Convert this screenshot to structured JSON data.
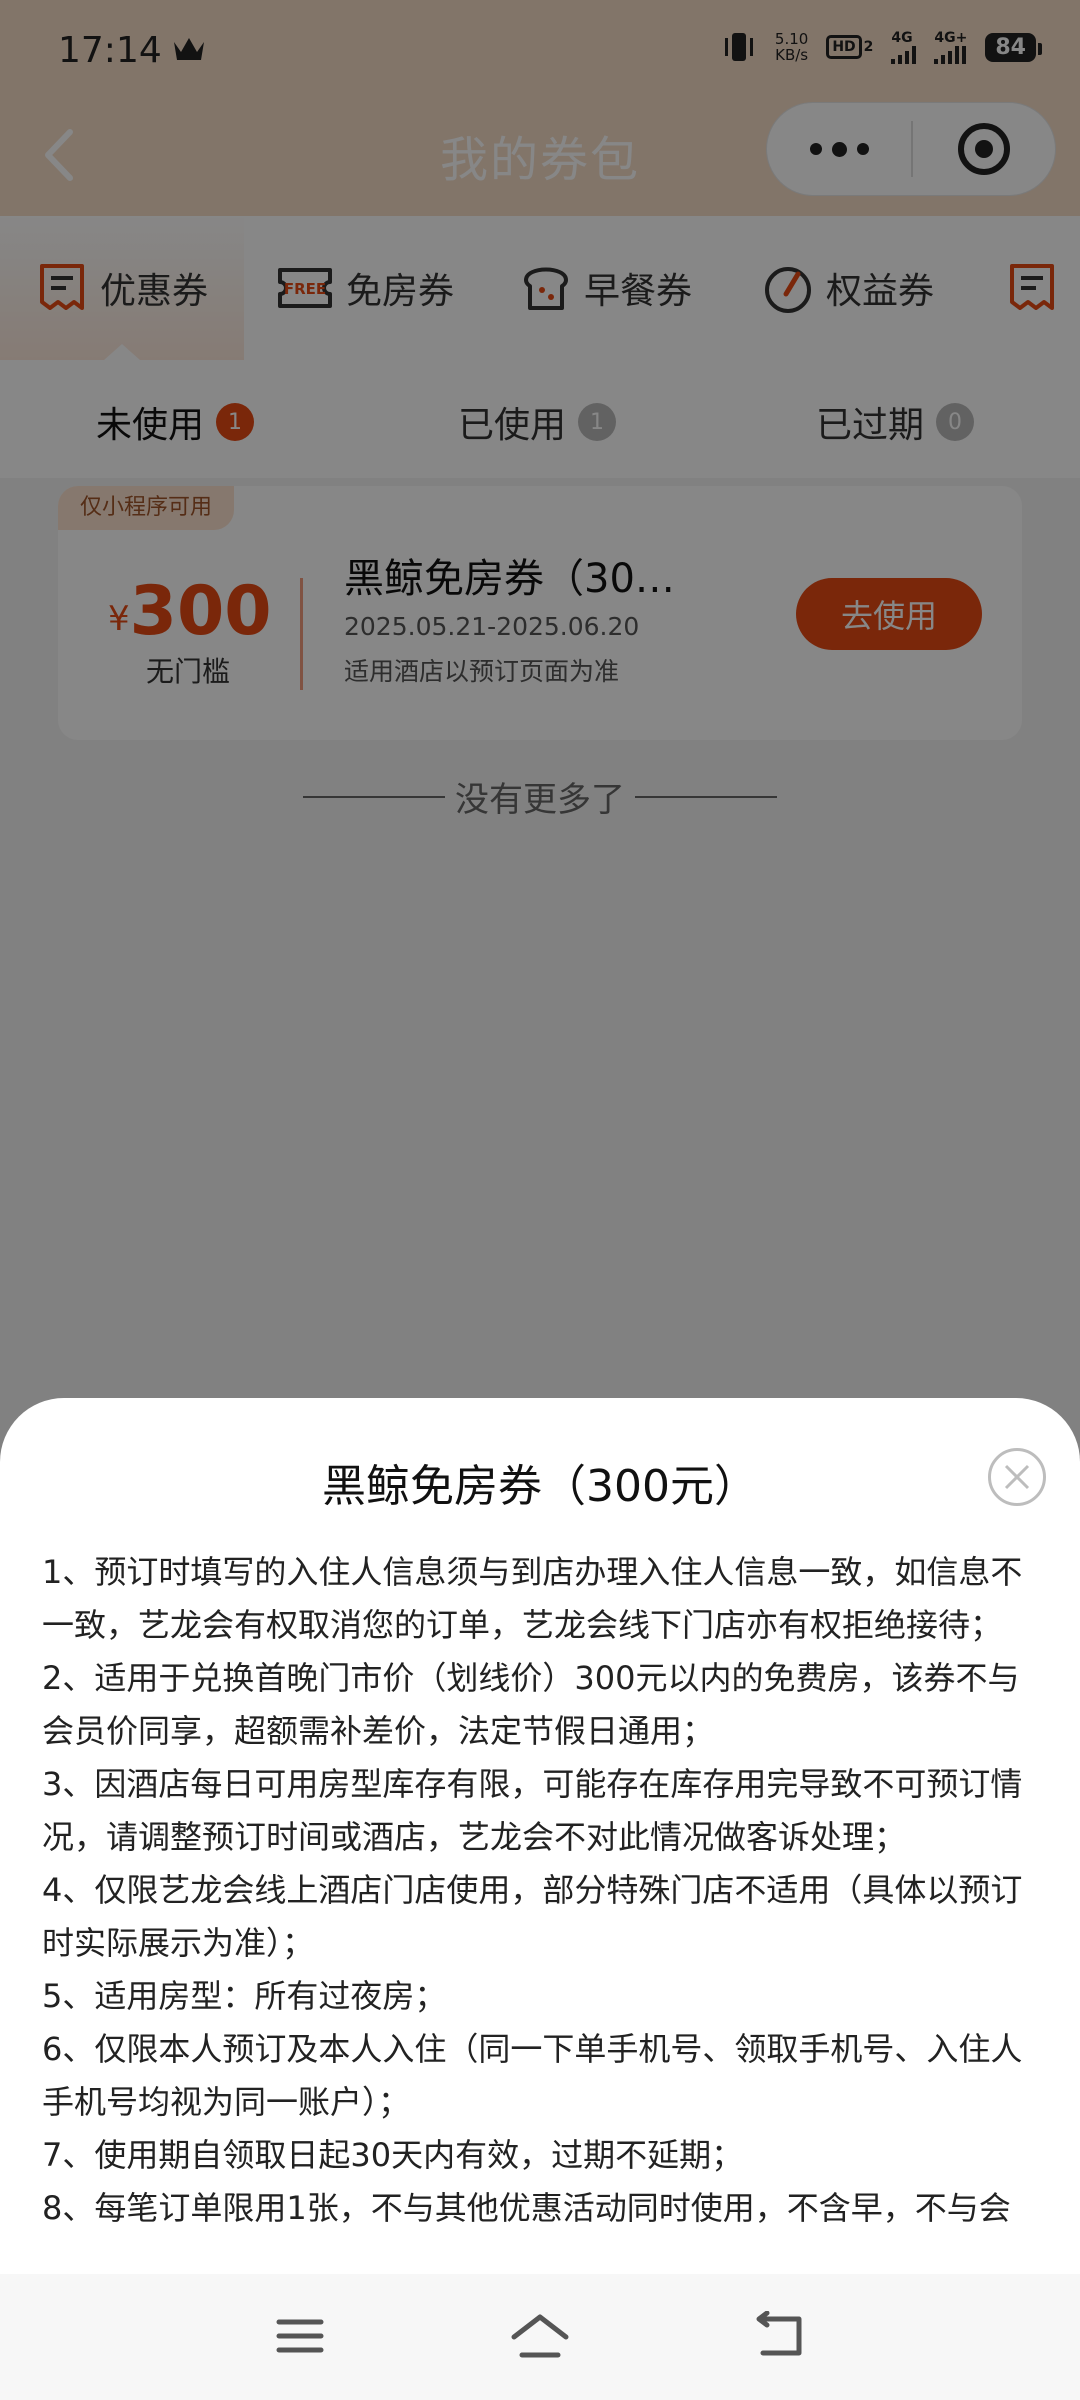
{
  "status_bar": {
    "time": "17:14",
    "net_speed_value": "5.10",
    "net_speed_unit": "KB/s",
    "hd_label": "HD",
    "sim2_label": "2",
    "net1": "4G",
    "net2": "4G+",
    "battery": "84"
  },
  "header": {
    "title": "我的券包"
  },
  "category_tabs": [
    {
      "label": "优惠券",
      "active": true
    },
    {
      "label": "免房券",
      "icon_text": "FREE"
    },
    {
      "label": "早餐券"
    },
    {
      "label": "权益券"
    }
  ],
  "status_tabs": [
    {
      "label": "未使用",
      "count": "1",
      "active": true
    },
    {
      "label": "已使用",
      "count": "1"
    },
    {
      "label": "已过期",
      "count": "0"
    }
  ],
  "coupon": {
    "tag": "仅小程序可用",
    "currency": "¥",
    "amount": "300",
    "condition": "无门槛",
    "name": "黑鲸免房券（30…",
    "date_range": "2025.05.21-2025.06.20",
    "scope": "适用酒店以预订页面为准",
    "button": "去使用"
  },
  "no_more": "没有更多了",
  "sheet": {
    "title": "黑鲸免房券（300元）",
    "rules": [
      "1、预订时填写的入住人信息须与到店办理入住人信息一致，如信息不一致，艺龙会有权取消您的订单，艺龙会线下门店亦有权拒绝接待；",
      "2、适用于兑换首晚门市价（划线价）300元以内的免费房，该券不与会员价同享，超额需补差价，法定节假日通用；",
      "3、因酒店每日可用房型库存有限，可能存在库存用完导致不可预订情况，请调整预订时间或酒店，艺龙会不对此情况做客诉处理；",
      "4、仅限艺龙会线上酒店门店使用，部分特殊门店不适用（具体以预订时实际展示为准）；",
      "5、适用房型：所有过夜房；",
      "6、仅限本人预订及本人入住（同一下单手机号、领取手机号、入住人手机号均视为同一账户）；",
      "7、使用期自领取日起30天内有效，过期不延期；",
      "8、每笔订单限用1张，不与其他优惠活动同时使用，不含早，不与会"
    ]
  },
  "colors": {
    "accent": "#e64a14",
    "header_bg": "#f6ddc7",
    "tag_bg": "#fde3d0"
  }
}
